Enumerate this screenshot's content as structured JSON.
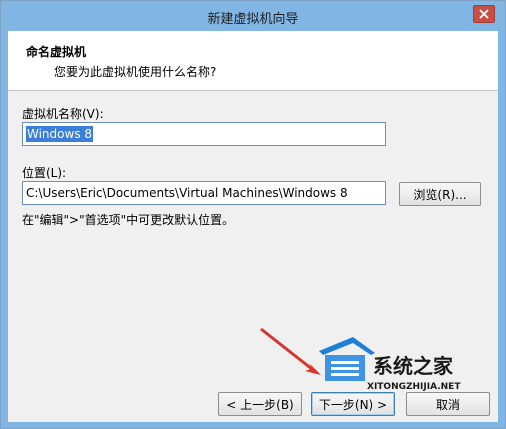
{
  "window": {
    "title": "新建虚拟机向导"
  },
  "header": {
    "title": "命名虚拟机",
    "subtitle": "您要为此虚拟机使用什么名称?"
  },
  "form": {
    "name_label": "虚拟机名称(V):",
    "name_value": "Windows 8",
    "location_label": "位置(L):",
    "location_value": "C:\\Users\\Eric\\Documents\\Virtual Machines\\Windows 8",
    "browse_label": "浏览(R)...",
    "hint": "在\"编辑\">\"首选项\"中可更改默认位置。"
  },
  "footer": {
    "back_label": "< 上一步(B)",
    "next_label": "下一步(N) >",
    "cancel_label": "取消"
  },
  "watermark": {
    "brand": "系统之家",
    "url": "XITONGZHIJIA.NET"
  },
  "colors": {
    "titlebar": "#80b5e4",
    "close": "#c74f45",
    "selection": "#3b7fd8",
    "arrow": "#d8322a"
  }
}
